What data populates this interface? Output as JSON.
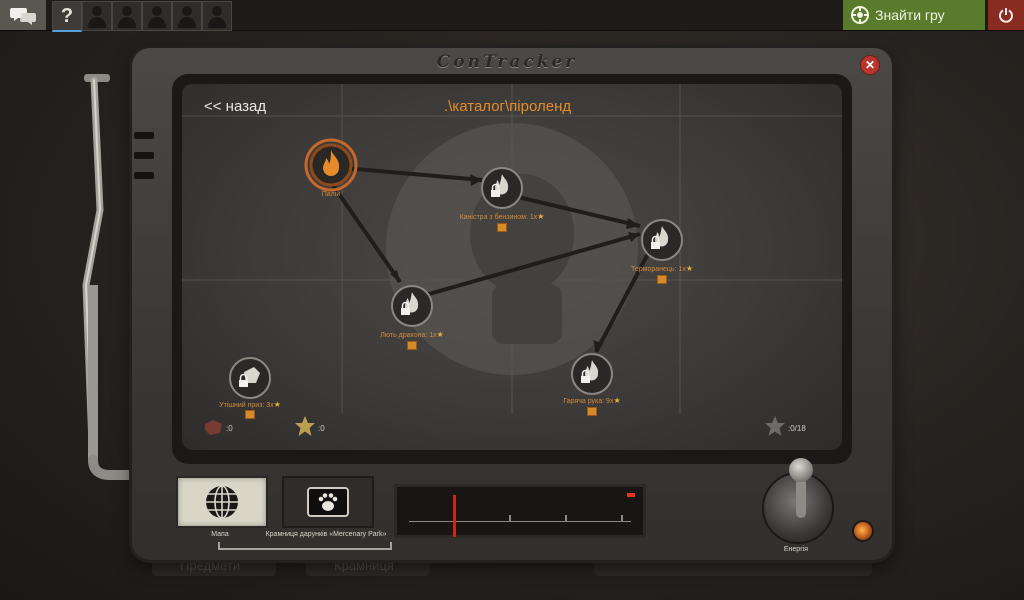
{
  "topbar": {
    "slot_question": "?",
    "find_game_label": "Знайти гру"
  },
  "background": {
    "items_label": "Предмети",
    "store_label": "Крамниця"
  },
  "contracker": {
    "brand": "ConTracker",
    "back_label": "<< назад",
    "path_label": ".\\каталог\\піроленд",
    "nodes": [
      {
        "id": "pyro",
        "label": "Палій",
        "locked": false,
        "stars": null
      },
      {
        "id": "canister",
        "label": "Каністра з бензином: 1x",
        "locked": true,
        "stars": "★"
      },
      {
        "id": "thermal",
        "label": "Терморанець: 1x",
        "locked": true,
        "stars": "★"
      },
      {
        "id": "dragon",
        "label": "Лють дракона: 1x",
        "locked": true,
        "stars": "★"
      },
      {
        "id": "hot-hand",
        "label": "Гаряча рука: 9x",
        "locked": true,
        "stars": "★"
      },
      {
        "id": "bonus",
        "label": "Утішний приз: 3x",
        "locked": true,
        "stars": "★"
      }
    ],
    "stats": {
      "contracts_value": ":0",
      "stars_value": ":0",
      "total_value": ":0/18"
    },
    "buttons": {
      "map_caption": "Мапа",
      "shop_caption": "Крамниця дарунків «Mercenary Park»",
      "energy_caption": "Енергія"
    },
    "gauge": {
      "level": 0.2
    },
    "colors": {
      "accent_orange": "#e58b2a",
      "find_game_green": "#5a7a2c",
      "quit_red": "#8a2b22",
      "needle_red": "#cf2418"
    },
    "icons": {
      "map": "globe-icon",
      "shop": "bear-paw-ticket-icon",
      "node": "flame-icon",
      "lock": "lock-icon",
      "close": "close-icon"
    }
  }
}
